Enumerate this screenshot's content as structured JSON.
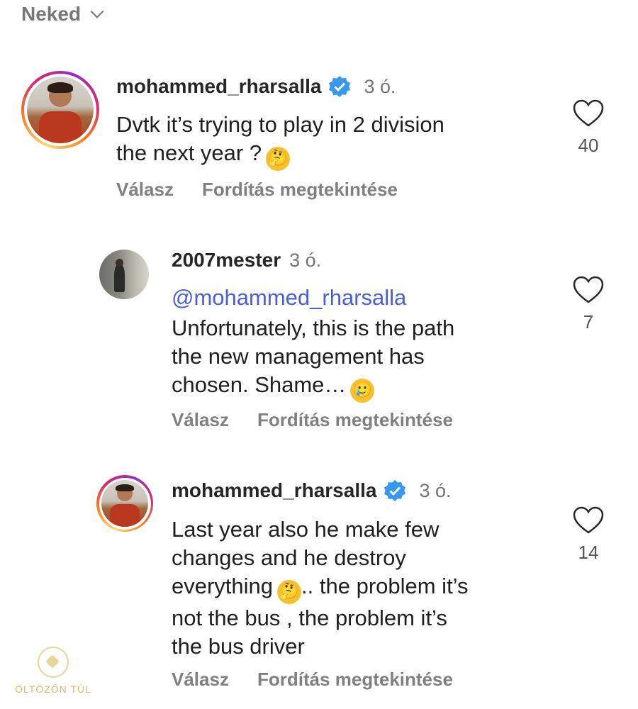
{
  "filter": {
    "label": "Neked"
  },
  "comments": [
    {
      "username": "mohammed_rharsalla",
      "verified": true,
      "time": "3 ó.",
      "lines": [
        "Dvtk it’s trying to play in 2 division",
        "the next year ?"
      ],
      "emoji": "🤔",
      "actions": {
        "reply": "Válasz",
        "translate": "Fordítás megtekintése"
      },
      "likes": "40"
    },
    {
      "username": "2007mester",
      "verified": false,
      "time": "3 ó.",
      "mention": "@mohammed_rharsalla",
      "lines": [
        "Unfortunately, this is the path",
        "the new management has",
        "chosen. Shame…"
      ],
      "emoji": "🥲",
      "actions": {
        "reply": "Válasz",
        "translate": "Fordítás megtekintése"
      },
      "likes": "7"
    },
    {
      "username": "mohammed_rharsalla",
      "verified": true,
      "time": "3 ó.",
      "lines": [
        "Last year also he make few",
        "changes and he destroy",
        "everything",
        ".. the problem it’s",
        "not the bus , the problem it’s",
        "the bus driver"
      ],
      "emoji": "🤔",
      "actions": {
        "reply": "Válasz",
        "translate": "Fordítás megtekintése"
      },
      "likes": "14"
    }
  ],
  "watermark": {
    "text": "ÖLTÖZŐN TÚL"
  },
  "colors": {
    "verified": "#3897f0",
    "mention": "#4a5fd6",
    "muted": "#737373"
  }
}
